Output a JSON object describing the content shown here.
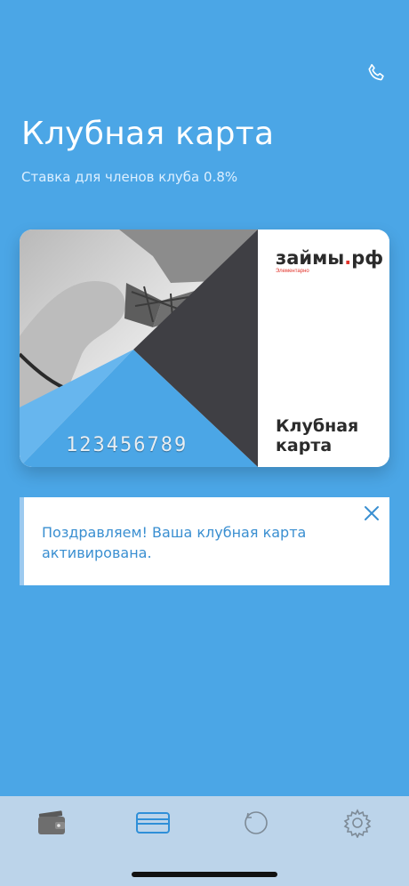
{
  "header": {
    "title": "Клубная карта",
    "subtitle": "Ставка для членов клуба 0.8%"
  },
  "card": {
    "brand_main": "займы",
    "brand_dot": ".",
    "brand_suffix": "рф",
    "tagline": "Элементарно",
    "title": "Клубная карта",
    "number": "123456789"
  },
  "notice": {
    "text": "Поздравляем! Ваша клубная карта активирована."
  },
  "tabbar": {
    "tabs": [
      {
        "icon": "wallet-icon",
        "active": false
      },
      {
        "icon": "card-icon",
        "active": true
      },
      {
        "icon": "history-icon",
        "active": false
      },
      {
        "icon": "gear-icon",
        "active": false
      }
    ]
  },
  "colors": {
    "background": "#4ba6e6",
    "accent": "#3a8fd1",
    "tabbar": "#bcd4ea",
    "brand_red": "#e2342b"
  }
}
